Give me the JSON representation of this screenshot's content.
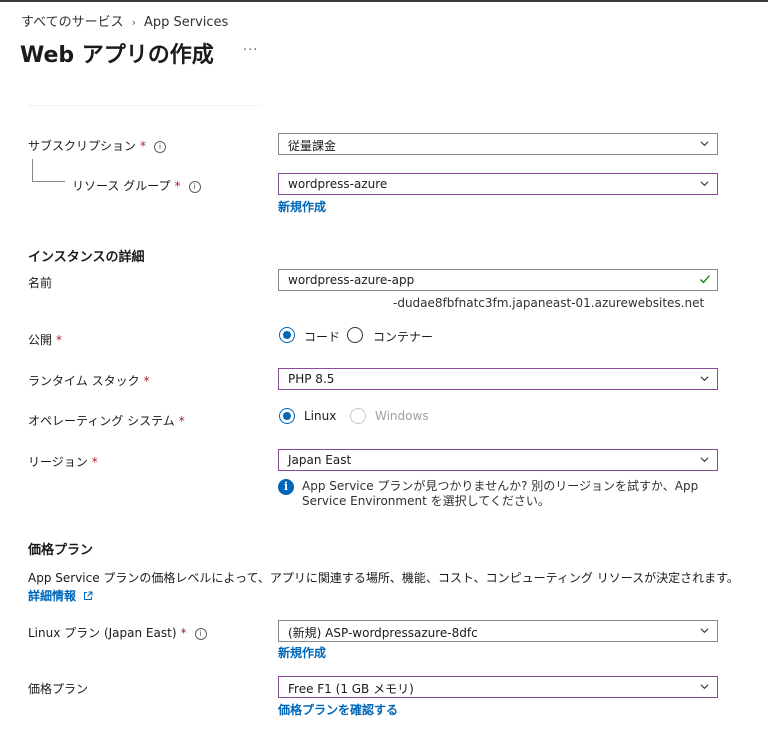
{
  "breadcrumb": {
    "root": "すべてのサービス",
    "separator": "›",
    "current": "App Services"
  },
  "page": {
    "title": "Web アプリの作成",
    "more": "···"
  },
  "subscription": {
    "label": "サブスクリプション",
    "required": "*",
    "value": "従量課金"
  },
  "resource_group": {
    "label": "リソース グループ",
    "required": "*",
    "value": "wordpress-azure",
    "create_link": "新規作成"
  },
  "instance": {
    "heading": "インスタンスの詳細",
    "name_label": "名前",
    "name_value": "wordpress-azure-app",
    "name_suffix": "-dudae8fbfnatc3fm.japaneast-01.azurewebsites.net",
    "publish_label": "公開",
    "publish_required": "*",
    "publish_options": [
      "コード",
      "コンテナー"
    ],
    "publish_selected": "コード",
    "runtime_label": "ランタイム スタック",
    "runtime_required": "*",
    "runtime_value": "PHP 8.5",
    "os_label": "オペレーティング システム",
    "os_required": "*",
    "os_options": [
      "Linux",
      "Windows"
    ],
    "os_selected": "Linux",
    "region_label": "リージョン",
    "region_required": "*",
    "region_value": "Japan East",
    "region_info": "App Service プランが見つかりませんか? 別のリージョンを試すか、App Service Environment を選択してください。"
  },
  "pricing": {
    "heading": "価格プラン",
    "description": "App Service プランの価格レベルによって、アプリに関連する場所、機能、コスト、コンピューティング リソースが決定されます。",
    "learn_more": "詳細情報",
    "plan_label": "Linux プラン (Japan East)",
    "plan_required": "*",
    "plan_value": "(新規) ASP-wordpressazure-8dfc",
    "plan_create_link": "新規作成",
    "tier_label": "価格プラン",
    "tier_value": "Free F1 (1 GB メモリ)",
    "tier_link": "価格プランを確認する"
  },
  "colors": {
    "accent": "#0067b8",
    "required": "#a4262c",
    "focus_border": "#8a4a9a",
    "valid": "#107c10"
  }
}
